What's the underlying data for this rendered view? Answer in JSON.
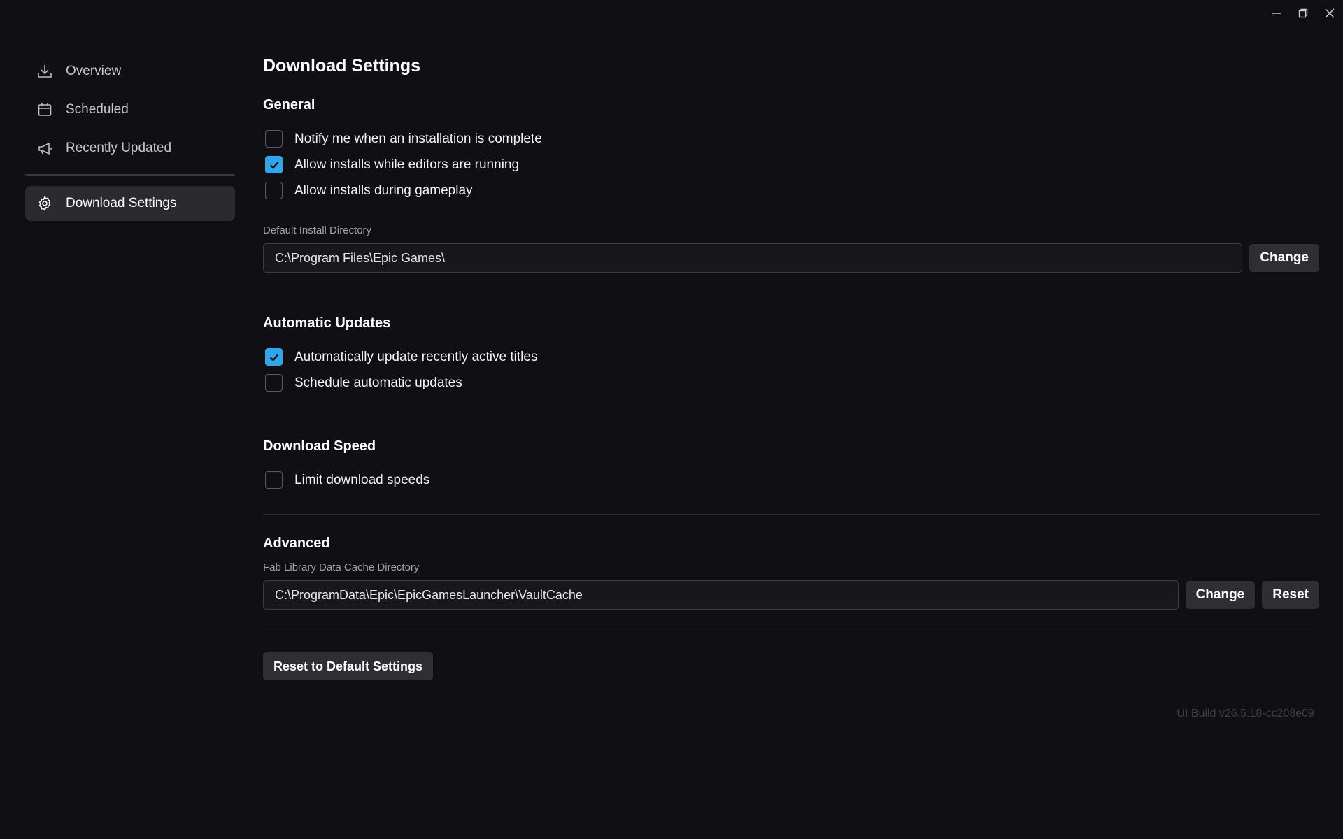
{
  "window": {
    "minimize_icon": "minimize-icon",
    "restore_icon": "restore-icon",
    "close_icon": "close-icon"
  },
  "sidebar": {
    "items": [
      {
        "label": "Overview",
        "icon": "download-icon"
      },
      {
        "label": "Scheduled",
        "icon": "calendar-icon"
      },
      {
        "label": "Recently Updated",
        "icon": "megaphone-icon"
      }
    ],
    "active_item": {
      "label": "Download Settings",
      "icon": "gear-icon"
    }
  },
  "main": {
    "title": "Download Settings",
    "general": {
      "title": "General",
      "options": [
        {
          "label": "Notify me when an installation is complete",
          "checked": false
        },
        {
          "label": "Allow installs while editors are running",
          "checked": true
        },
        {
          "label": "Allow installs during gameplay",
          "checked": false
        }
      ],
      "install_dir_label": "Default Install Directory",
      "install_dir_value": "C:\\Program Files\\Epic Games\\",
      "change_label": "Change"
    },
    "automatic_updates": {
      "title": "Automatic Updates",
      "options": [
        {
          "label": "Automatically update recently active titles",
          "checked": true
        },
        {
          "label": "Schedule automatic updates",
          "checked": false
        }
      ]
    },
    "download_speed": {
      "title": "Download Speed",
      "options": [
        {
          "label": "Limit download speeds",
          "checked": false
        }
      ]
    },
    "advanced": {
      "title": "Advanced",
      "cache_dir_label": "Fab Library Data Cache Directory",
      "cache_dir_value": "C:\\ProgramData\\Epic\\EpicGamesLauncher\\VaultCache",
      "change_label": "Change",
      "reset_label": "Reset"
    },
    "reset_defaults_label": "Reset to Default Settings",
    "version": "UI Build v26.5.18-cc208e09"
  },
  "colors": {
    "background": "#101014",
    "accent": "#2fa7ec",
    "active_nav": "#2a2a2f",
    "button": "#2e2e33"
  }
}
